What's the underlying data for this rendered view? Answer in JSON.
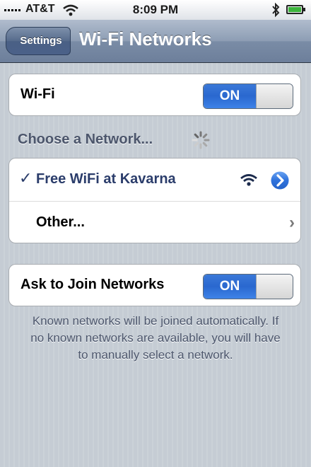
{
  "status_bar": {
    "carrier": "AT&T",
    "time": "8:09 PM",
    "icons": [
      "signal-icon",
      "wifi-icon",
      "bluetooth-icon",
      "battery-icon"
    ]
  },
  "nav": {
    "back_label": "Settings",
    "title": "Wi-Fi Networks"
  },
  "wifi": {
    "label": "Wi-Fi",
    "toggle_label": "ON"
  },
  "choose_section": {
    "header": "Choose a Network..."
  },
  "networks": [
    {
      "name": "Free WiFi at Kavarna",
      "selected": true,
      "checkmark": "✓"
    },
    {
      "name": "Other...",
      "selected": false
    }
  ],
  "ask_to_join": {
    "label": "Ask to Join Networks",
    "toggle_label": "ON"
  },
  "footnote": "Known networks will be joined automatically.  If no known networks are available, you will have to manually select a network.",
  "colors": {
    "accent_blue": "#2a68cf",
    "network_text": "#2b3d6b",
    "section_text": "#4c566c",
    "background": "#c5ccd4"
  }
}
